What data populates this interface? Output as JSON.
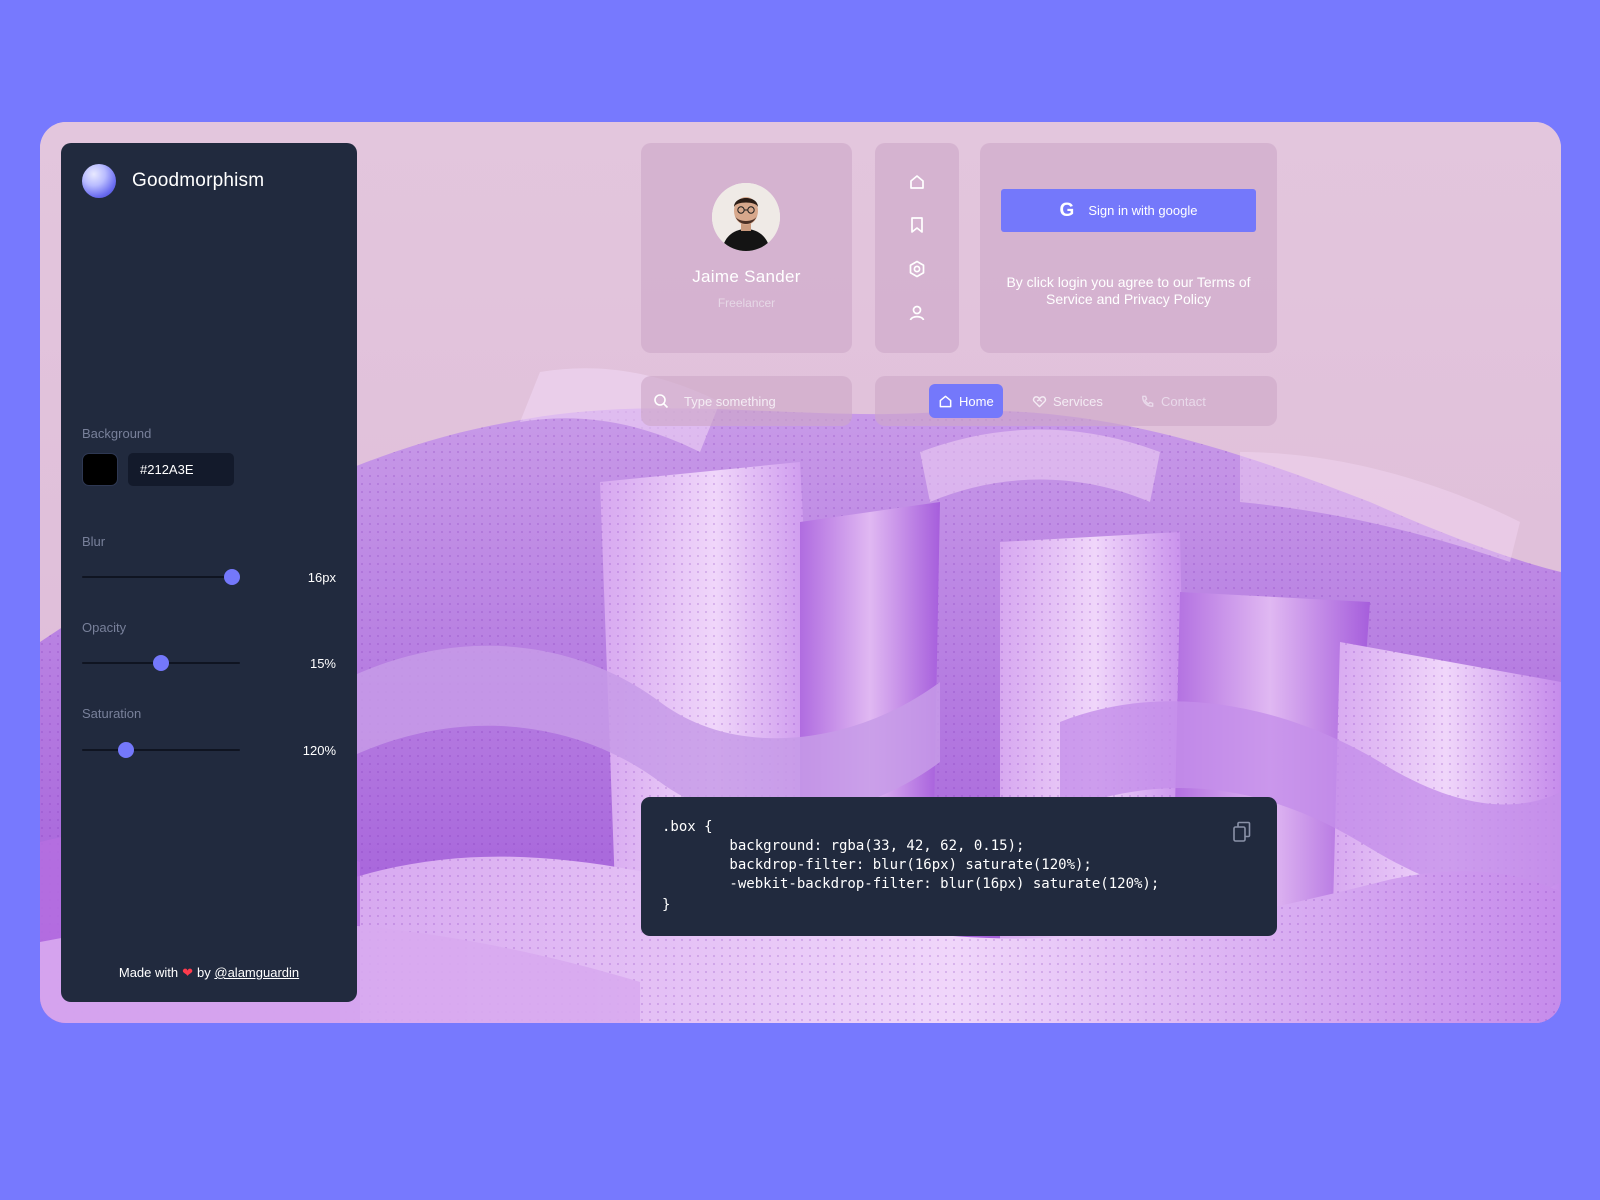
{
  "app": {
    "title": "Goodmorphism"
  },
  "controls": {
    "background": {
      "label": "Background",
      "value": "#212A3E",
      "swatch_color": "#000000"
    },
    "blur": {
      "label": "Blur",
      "value_text": "16px",
      "fraction": 0.95
    },
    "opacity": {
      "label": "Opacity",
      "value_text": "15%",
      "fraction": 0.5
    },
    "saturation": {
      "label": "Saturation",
      "value_text": "120%",
      "fraction": 0.28
    }
  },
  "footer": {
    "made_with": "Made with",
    "by": "by",
    "handle": "@alamguardin"
  },
  "profile": {
    "name": "Jaime Sander",
    "role": "Freelancer"
  },
  "icon_bar": {
    "icons": [
      "home-icon",
      "bookmark-icon",
      "settings-icon",
      "user-icon"
    ]
  },
  "login": {
    "button_label": "Sign in with google",
    "google_glyph": "G",
    "terms": "By click login you agree to our Terms of Service and Privacy Policy"
  },
  "search": {
    "placeholder": "Type something"
  },
  "nav": {
    "home": "Home",
    "services": "Services",
    "contact": "Contact"
  },
  "code": {
    "lines": [
      ".box {",
      "        background: rgba(33, 42, 62, 0.15);",
      "        backdrop-filter: blur(16px) saturate(120%);",
      "        -webkit-backdrop-filter: blur(16px) saturate(120%);",
      "}"
    ]
  },
  "colors": {
    "page_bg": "#7779FE",
    "accent": "#7478FB",
    "panel": "#212A3E"
  }
}
